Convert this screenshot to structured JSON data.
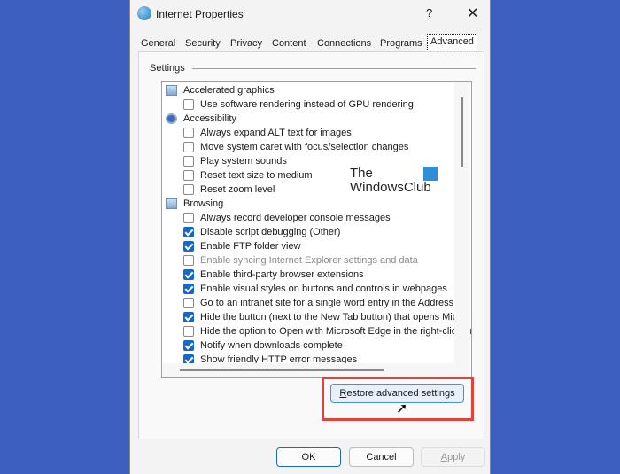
{
  "window": {
    "title": "Internet Properties",
    "help": "?",
    "close": "✕"
  },
  "tabs": [
    {
      "label": "General"
    },
    {
      "label": "Security"
    },
    {
      "label": "Privacy"
    },
    {
      "label": "Content"
    },
    {
      "label": "Connections"
    },
    {
      "label": "Programs"
    },
    {
      "label": "Advanced",
      "active": true
    }
  ],
  "settings": {
    "group_label": "Settings",
    "items": [
      {
        "type": "category",
        "icon": "monitor-icon",
        "label": "Accelerated graphics"
      },
      {
        "type": "checkbox",
        "checked": false,
        "label": "Use software rendering instead of GPU rendering"
      },
      {
        "type": "category",
        "icon": "accessibility-icon",
        "label": "Accessibility"
      },
      {
        "type": "checkbox",
        "checked": false,
        "label": "Always expand ALT text for images"
      },
      {
        "type": "checkbox",
        "checked": false,
        "label": "Move system caret with focus/selection changes"
      },
      {
        "type": "checkbox",
        "checked": false,
        "label": "Play system sounds"
      },
      {
        "type": "checkbox",
        "checked": false,
        "label": "Reset text size to medium"
      },
      {
        "type": "checkbox",
        "checked": false,
        "label": "Reset zoom level"
      },
      {
        "type": "category",
        "icon": "browser-window-icon",
        "label": "Browsing"
      },
      {
        "type": "checkbox",
        "checked": false,
        "label": "Always record developer console messages"
      },
      {
        "type": "checkbox",
        "checked": true,
        "label": "Disable script debugging (Other)"
      },
      {
        "type": "checkbox",
        "checked": true,
        "label": "Enable FTP folder view"
      },
      {
        "type": "checkbox",
        "checked": false,
        "disabled": true,
        "label": "Enable syncing Internet Explorer settings and data"
      },
      {
        "type": "checkbox",
        "checked": true,
        "label": "Enable third-party browser extensions"
      },
      {
        "type": "checkbox",
        "checked": true,
        "label": "Enable visual styles on buttons and controls in webpages"
      },
      {
        "type": "checkbox",
        "checked": false,
        "label": "Go to an intranet site for a single word entry in the Address bar"
      },
      {
        "type": "checkbox",
        "checked": true,
        "label": "Hide the button (next to the New Tab button) that opens Microsoft Edge"
      },
      {
        "type": "checkbox",
        "checked": false,
        "label": "Hide the option to Open with Microsoft Edge in the right-click menu"
      },
      {
        "type": "checkbox",
        "checked": true,
        "label": "Notify when downloads complete"
      },
      {
        "type": "checkbox",
        "checked": true,
        "label": "Show friendly HTTP error messages"
      }
    ]
  },
  "watermark": {
    "line1": "The",
    "line2": "WindowsClub"
  },
  "buttons": {
    "restore_prefix": "R",
    "restore_rest": "estore advanced settings",
    "ok": "OK",
    "cancel": "Cancel",
    "apply_prefix": "A",
    "apply_rest": "pply"
  },
  "colors": {
    "background": "#3d5fc0",
    "accent": "#1967c4",
    "highlight": "#e0433c"
  }
}
